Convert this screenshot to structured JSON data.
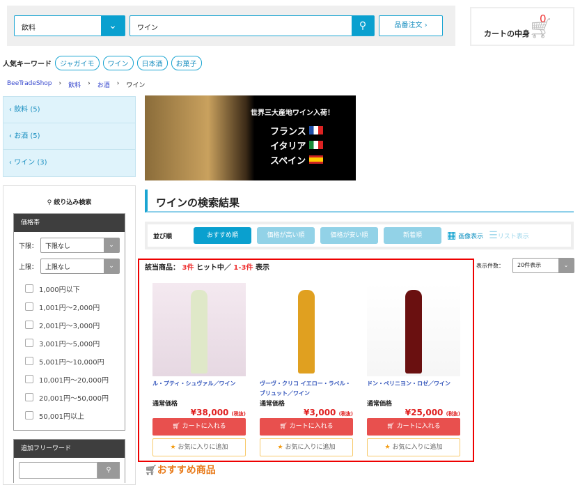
{
  "header": {
    "category": "飲料",
    "query": "ワイン",
    "part_order": "品番注文 ›",
    "cart_label": "カートの中身",
    "cart_count": "0"
  },
  "keywords": {
    "label": "人気キーワード",
    "items": [
      "ジャガイモ",
      "ワイン",
      "日本酒",
      "お菓子"
    ]
  },
  "breadcrumb": [
    "BeeTradeShop",
    "飲料",
    "お酒",
    "ワイン"
  ],
  "category_nav": [
    "飲料 (5)",
    "お酒 (5)",
    "ワイン (3)"
  ],
  "banner": {
    "headline": "世界三大産地ワイン入荷！",
    "countries": [
      "フランス",
      "イタリア",
      "スペイン"
    ]
  },
  "filter": {
    "title": "絞り込み検索",
    "price_header": "価格帯",
    "lower_label": "下限：",
    "lower_value": "下限なし",
    "upper_label": "上限：",
    "upper_value": "上限なし",
    "ranges": [
      "1,000円以下",
      "1,001円～2,000円",
      "2,001円～3,000円",
      "3,001円～5,000円",
      "5,001円～10,000円",
      "10,001円～20,000円",
      "20,001円～50,000円",
      "50,001円以上"
    ],
    "free_word_header": "追加フリーワード",
    "free_word_value": ""
  },
  "results": {
    "title": "ワインの検索結果",
    "sort_label": "並び順",
    "sorts": [
      "おすすめ順",
      "価格が高い順",
      "価格が安い順",
      "新着順"
    ],
    "view_image": "画像表示",
    "view_list": "リスト表示",
    "count_prefix": "該当商品：",
    "count": "3件",
    "count_mid": "ヒット中／",
    "range": "1-3件",
    "count_suffix": "表示",
    "per_page_label": "表示件数：",
    "per_page": "20件表示"
  },
  "products": [
    {
      "name": "ル・プティ・シュヴァル／ワイン",
      "price_label": "通常価格",
      "price": "¥38,000",
      "tax": "(税抜)",
      "cart": "カートに入れる",
      "fav": "お気に入りに追加"
    },
    {
      "name": "ヴーヴ・クリコ イエロー・ラベル・ブリュット／ワイン",
      "price_label": "通常価格",
      "price": "¥3,000",
      "tax": "(税抜)",
      "cart": "カートに入れる",
      "fav": "お気に入りに追加"
    },
    {
      "name": "ドン・ペリニヨン・ロゼ／ワイン",
      "price_label": "通常価格",
      "price": "¥25,000",
      "tax": "(税抜)",
      "cart": "カートに入れる",
      "fav": "お気に入りに追加"
    }
  ],
  "recommend_title": "おすすめ商品"
}
